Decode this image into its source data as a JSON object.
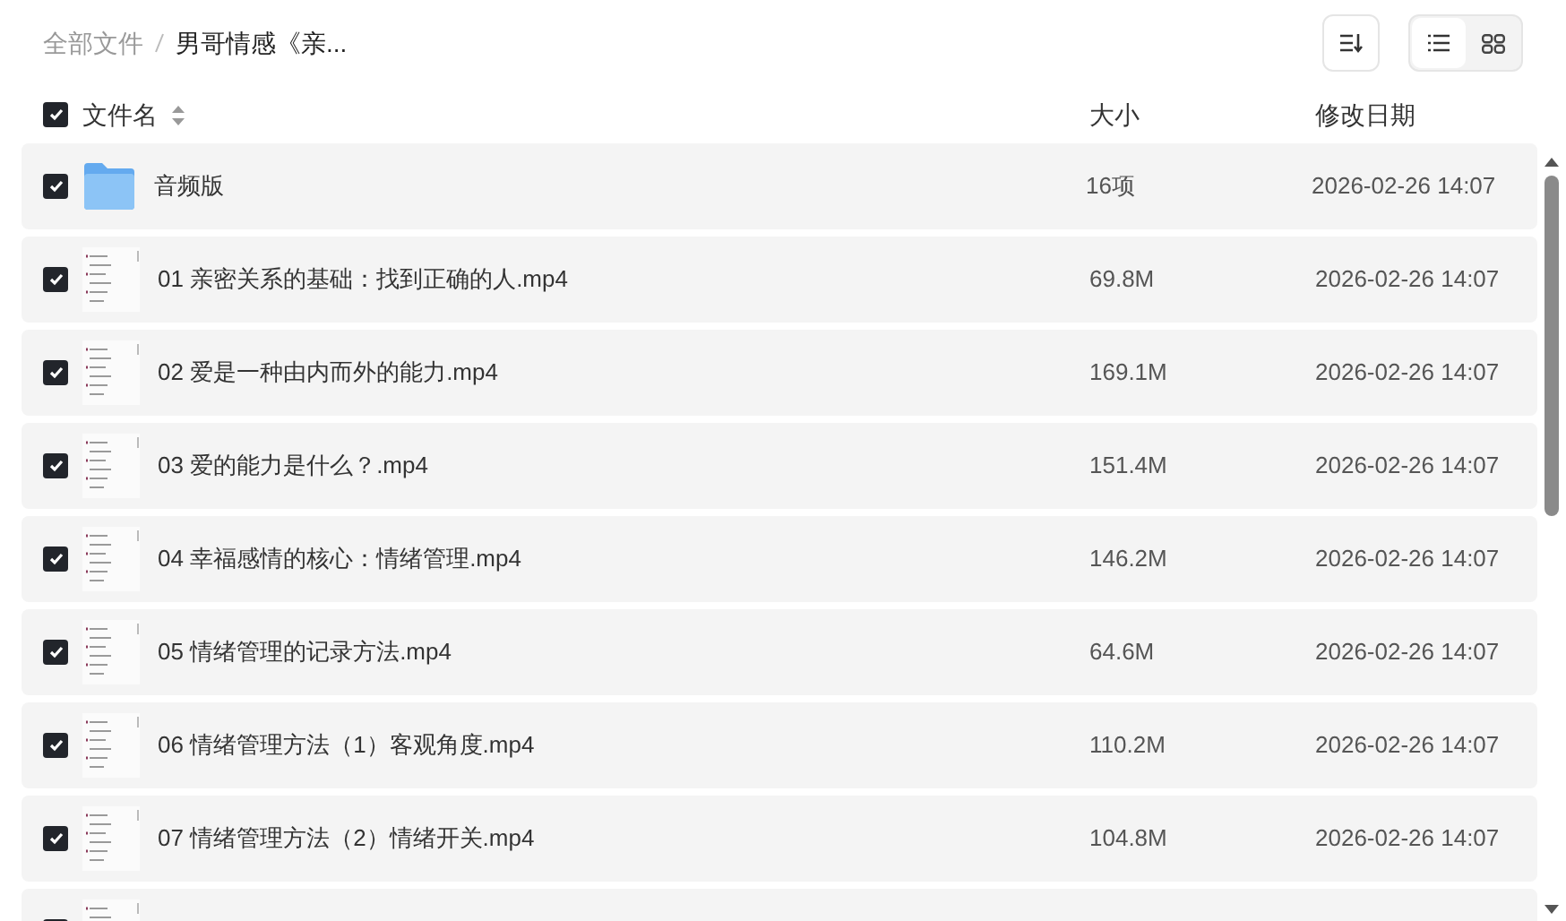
{
  "breadcrumb": [
    {
      "label": "全部文件",
      "current": false
    },
    {
      "label": "男哥情感《亲...",
      "current": true
    }
  ],
  "view_modes": [
    {
      "kind": "list",
      "selected": true
    },
    {
      "kind": "grid",
      "selected": false
    }
  ],
  "table": {
    "select_all_checked": true,
    "columns": [
      "文件名",
      "大小",
      "修改日期"
    ],
    "rows": [
      {
        "kind": "folder",
        "checked": true,
        "name": "音频版",
        "size": "16项",
        "date": "2026-02-26 14:07"
      },
      {
        "kind": "video",
        "checked": true,
        "name": "01 亲密关系的基础：找到正确的人.mp4",
        "size": "69.8M",
        "date": "2026-02-26 14:07"
      },
      {
        "kind": "video",
        "checked": true,
        "name": "02 爱是一种由内而外的能力.mp4",
        "size": "169.1M",
        "date": "2026-02-26 14:07"
      },
      {
        "kind": "video",
        "checked": true,
        "name": "03 爱的能力是什么？.mp4",
        "size": "151.4M",
        "date": "2026-02-26 14:07"
      },
      {
        "kind": "video",
        "checked": true,
        "name": "04 幸福感情的核心：情绪管理.mp4",
        "size": "146.2M",
        "date": "2026-02-26 14:07"
      },
      {
        "kind": "video",
        "checked": true,
        "name": "05 情绪管理的记录方法.mp4",
        "size": "64.6M",
        "date": "2026-02-26 14:07"
      },
      {
        "kind": "video",
        "checked": true,
        "name": "06 情绪管理方法（1）客观角度.mp4",
        "size": "110.2M",
        "date": "2026-02-26 14:07"
      },
      {
        "kind": "video",
        "checked": true,
        "name": "07 情绪管理方法（2）情绪开关.mp4",
        "size": "104.8M",
        "date": "2026-02-26 14:07"
      },
      {
        "kind": "video",
        "checked": true
      }
    ]
  }
}
